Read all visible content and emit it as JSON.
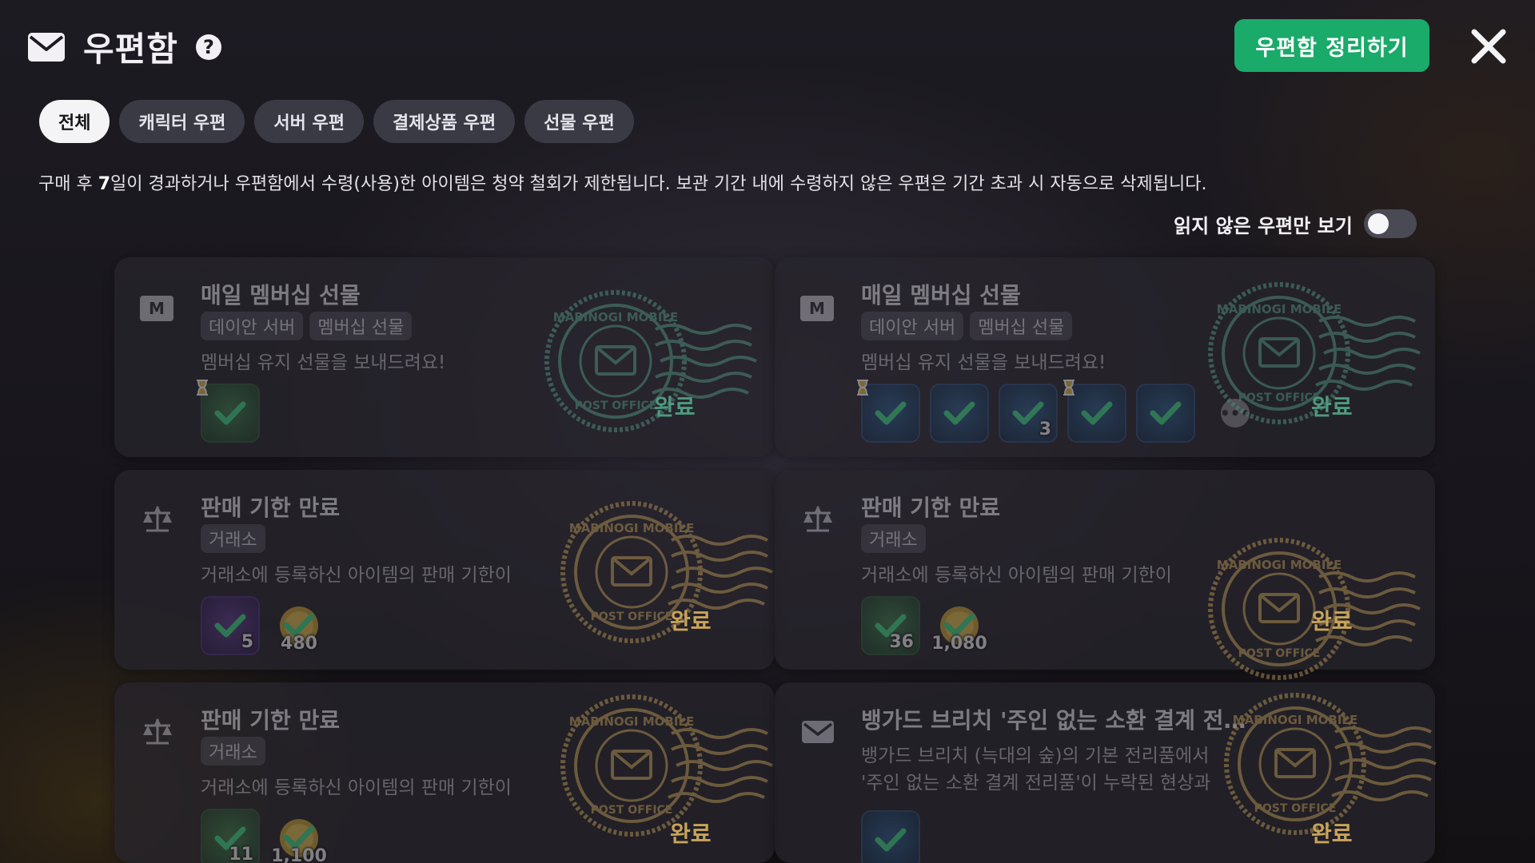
{
  "header": {
    "title": "우편함",
    "help": "?",
    "organize_label": "우편함 정리하기"
  },
  "tabs": [
    {
      "label": "전체",
      "active": true
    },
    {
      "label": "캐릭터 우편",
      "active": false
    },
    {
      "label": "서버 우편",
      "active": false
    },
    {
      "label": "결제상품 우편",
      "active": false
    },
    {
      "label": "선물 우편",
      "active": false
    }
  ],
  "notice": {
    "prefix": "구매 후 ",
    "days": "7",
    "suffix": "일이 경과하거나 우편함에서 수령(사용)한 아이템은 청약 철회가 제한됩니다. 보관 기간 내에 수령하지 않은 우편은 기간 초과 시 자동으로 삭제됩니다."
  },
  "unread_filter": {
    "label": "읽지 않은 우편만 보기",
    "on": false
  },
  "stamp": {
    "top": "MABINOGI MOBILE",
    "bottom": "POST OFFICE"
  },
  "mails": [
    {
      "icon": "membership-m-icon",
      "badge": "M",
      "title": "매일 멤버십 선물",
      "chips": [
        "데이안 서버",
        "멤버십 선물"
      ],
      "desc": "멤버십 유지 선물을 보내드려요!",
      "status": "완료",
      "items": [
        {
          "kind": "green",
          "qty": "",
          "timer": true
        }
      ]
    },
    {
      "icon": "membership-m-icon",
      "badge": "M",
      "title": "매일 멤버십 선물",
      "chips": [
        "데이안 서버",
        "멤버십 선물"
      ],
      "desc": "멤버십 유지 선물을 보내드려요!",
      "status": "완료",
      "items": [
        {
          "kind": "blue",
          "qty": "",
          "timer": true
        },
        {
          "kind": "blue",
          "qty": ""
        },
        {
          "kind": "blue",
          "qty": "3"
        },
        {
          "kind": "blue",
          "qty": "",
          "timer": true
        },
        {
          "kind": "blue",
          "qty": ""
        }
      ],
      "more": "•••"
    },
    {
      "icon": "scale-icon",
      "title": "판매 기한 만료",
      "chips": [
        "거래소"
      ],
      "desc": "거래소에 등록하신 아이템의 판매 기한이",
      "status": "완료",
      "items": [
        {
          "kind": "purple",
          "qty": "5"
        },
        {
          "kind": "coin",
          "qty": "480"
        }
      ]
    },
    {
      "icon": "scale-icon",
      "title": "판매 기한 만료",
      "chips": [
        "거래소"
      ],
      "desc": "거래소에 등록하신 아이템의 판매 기한이",
      "status": "완료",
      "items": [
        {
          "kind": "green",
          "qty": "36"
        },
        {
          "kind": "coin",
          "qty": "1,080"
        }
      ]
    },
    {
      "icon": "scale-icon",
      "title": "판매 기한 만료",
      "chips": [
        "거래소"
      ],
      "desc": "거래소에 등록하신 아이템의 판매 기한이",
      "status": "완료",
      "items": [
        {
          "kind": "green",
          "qty": "11"
        },
        {
          "kind": "coin",
          "qty": "1,100"
        }
      ]
    },
    {
      "icon": "envelope-icon",
      "title": "뱅가드 브리치 '주인 없는 소환 결계 전…",
      "chips": [],
      "desc": "뱅가드 브리치 (늑대의 숲)의 기본 전리품에서",
      "desc2": "'주인 없는 소환 결계 전리품'이 누락된 현상과",
      "status": "완료",
      "items": [
        {
          "kind": "blue",
          "qty": ""
        }
      ]
    }
  ]
}
